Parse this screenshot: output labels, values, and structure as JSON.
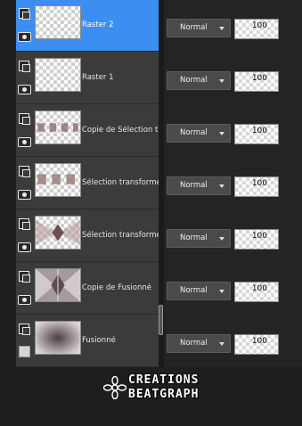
{
  "layers": [
    {
      "name": "Raster 2",
      "selected": true,
      "visible_icon": "eye-icon",
      "blend_mode": "Normal",
      "opacity": "100"
    },
    {
      "name": "Raster 1",
      "selected": false,
      "visible_icon": "eye-icon",
      "blend_mode": "Normal",
      "opacity": "100"
    },
    {
      "name": "Copie de Sélection tra",
      "selected": false,
      "visible_icon": "eye-icon",
      "blend_mode": "Normal",
      "opacity": "100"
    },
    {
      "name": "Sélection transformée",
      "selected": false,
      "visible_icon": "eye-icon",
      "blend_mode": "Normal",
      "opacity": "100"
    },
    {
      "name": "Sélection transformée",
      "selected": false,
      "visible_icon": "eye-icon",
      "blend_mode": "Normal",
      "opacity": "100"
    },
    {
      "name": "Copie de Fusionné",
      "selected": false,
      "visible_icon": "eye-icon",
      "blend_mode": "Normal",
      "opacity": "100"
    },
    {
      "name": "Fusionné",
      "selected": false,
      "visible_icon": "mask-icon",
      "blend_mode": "Normal",
      "opacity": "100"
    }
  ],
  "watermark": {
    "line1": "CREATIONS",
    "line2": "BEATGRAPH"
  },
  "colors": {
    "selected": "#3d8ef1",
    "panel": "#3b3b3b",
    "background": "#1e1e1e"
  }
}
